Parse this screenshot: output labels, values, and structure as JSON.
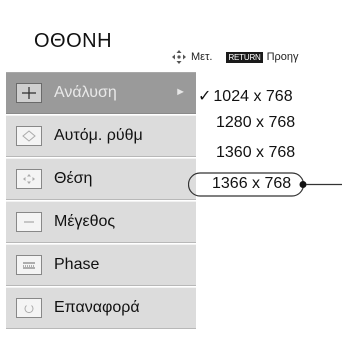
{
  "header": {
    "title": "ΟΘΟΝΗ",
    "move_icon": "four-way-arrow-icon",
    "move_label": "Μετ.",
    "return_key": "RETURN",
    "return_label": "Προηγ"
  },
  "menu": {
    "items": [
      {
        "label": "Ανάλυση",
        "icon": "crosshair-icon",
        "active": true
      },
      {
        "label": "Αυτόμ. ρύθμ",
        "icon": "auto-adjust-icon",
        "active": false
      },
      {
        "label": "Θέση",
        "icon": "position-icon",
        "active": false
      },
      {
        "label": "Μέγεθος",
        "icon": "size-icon",
        "active": false
      },
      {
        "label": "Phase",
        "icon": "phase-icon",
        "active": false
      },
      {
        "label": "Επαναφορά",
        "icon": "reset-icon",
        "active": false
      }
    ],
    "submenu_arrow": "►"
  },
  "resolution_options": {
    "checkmark": "✓",
    "items": [
      {
        "label": "1024 x 768",
        "checked": true,
        "highlighted": false
      },
      {
        "label": "1280 x 768",
        "checked": false,
        "highlighted": false
      },
      {
        "label": "1360 x 768",
        "checked": false,
        "highlighted": false
      },
      {
        "label": "1366 x 768",
        "checked": false,
        "highlighted": true
      }
    ]
  },
  "colors": {
    "active_item_bg": "#9a9a9a",
    "item_bg": "#dcdcdc",
    "text": "#111111"
  }
}
